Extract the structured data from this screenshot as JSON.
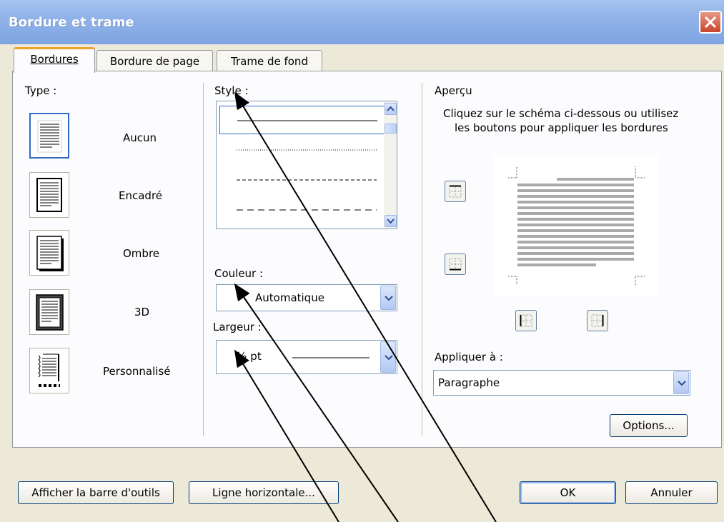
{
  "window": {
    "title": "Bordure et trame"
  },
  "tabs": [
    {
      "label": "Bordures",
      "active": true
    },
    {
      "label": "Bordure de page",
      "active": false
    },
    {
      "label": "Trame de fond",
      "active": false
    }
  ],
  "type_section": {
    "label": "Type :",
    "options": [
      {
        "label": "Aucun",
        "selected": true
      },
      {
        "label": "Encadré",
        "selected": false
      },
      {
        "label": "Ombre",
        "selected": false
      },
      {
        "label": "3D",
        "selected": false
      },
      {
        "label": "Personnalisé",
        "selected": false
      }
    ]
  },
  "style_section": {
    "label": "Style :",
    "line_styles": [
      "solid",
      "dotted",
      "dashed",
      "long-dashed"
    ],
    "selected": "solid"
  },
  "color_section": {
    "label": "Couleur :",
    "value": "Automatique"
  },
  "width_section": {
    "label": "Largeur :",
    "value": "½ pt"
  },
  "preview_section": {
    "label": "Aperçu",
    "instructions_line1": "Cliquez sur le schéma ci-dessous ou utilisez",
    "instructions_line2": "les boutons pour appliquer les bordures"
  },
  "apply_section": {
    "label": "Appliquer à :",
    "value": "Paragraphe"
  },
  "buttons": {
    "options": "Options...",
    "toolbar": "Afficher la barre d'outils",
    "horizontal_line": "Ligne horizontale...",
    "ok": "OK",
    "cancel": "Annuler"
  },
  "colors": {
    "titlebar": "#8fb1e8",
    "dialog_bg": "#ece9d8",
    "active_tab_accent": "#f0a22e",
    "selection": "#316ac5",
    "close_button": "#c9452a"
  },
  "icons": [
    "close-icon",
    "scroll-up-icon",
    "scroll-down-icon",
    "dropdown-arrow-icon",
    "border-top-icon",
    "border-bottom-icon",
    "border-left-icon",
    "border-right-icon"
  ]
}
